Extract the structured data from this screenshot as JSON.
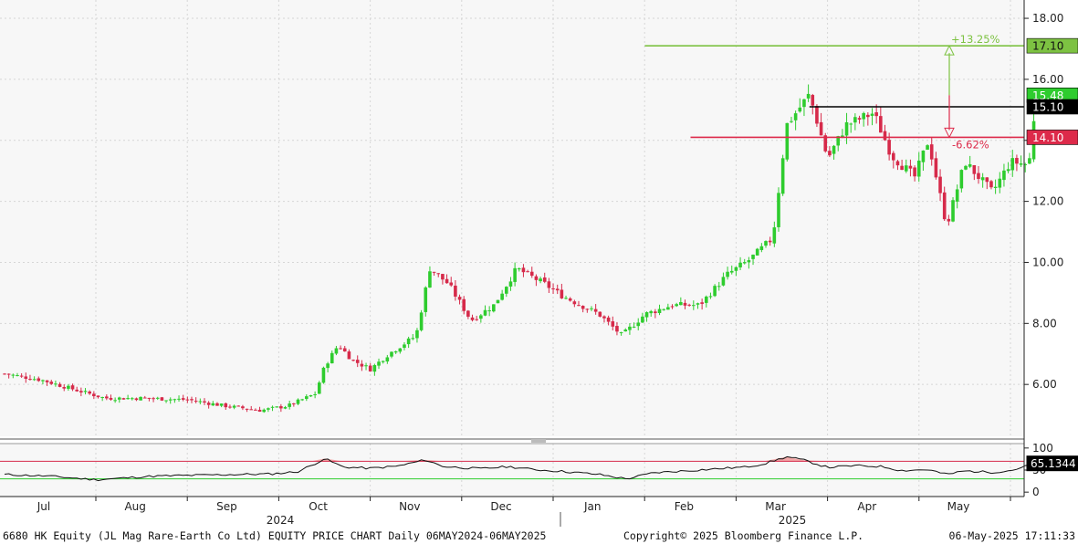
{
  "chart_data": {
    "type": "candlestick",
    "ticker_line": "6680 HK Equity (JL Mag Rare-Earth Co Ltd) EQUITY PRICE CHART  Daily 06MAY2024-06MAY2025",
    "copyright": "Copyright© 2025 Bloomberg Finance L.P.",
    "timestamp": "06-May-2025 17:11:33",
    "price_axis": {
      "ylim": [
        4.3,
        18.6
      ],
      "ticks": [
        {
          "v": 6,
          "label": "6.00"
        },
        {
          "v": 8,
          "label": "8.00"
        },
        {
          "v": 10,
          "label": "10.00"
        },
        {
          "v": 12,
          "label": "12.00"
        },
        {
          "v": 14,
          "label": "14.00"
        },
        {
          "v": 16,
          "label": "16.00"
        },
        {
          "v": 18,
          "label": "18.00"
        }
      ]
    },
    "rsi_axis": {
      "ylim": [
        -10,
        110
      ],
      "ticks": [
        {
          "v": 100,
          "label": "100"
        },
        {
          "v": 50,
          "label": "50"
        },
        {
          "v": 0,
          "label": "0"
        }
      ],
      "upper": 70,
      "lower": 30,
      "current": {
        "v": 65.1344,
        "label": "65.1344"
      }
    },
    "months": [
      "Jul",
      "Aug",
      "Sep",
      "Oct",
      "Nov",
      "Dec",
      "Jan",
      "Feb",
      "Mar",
      "Apr",
      "May"
    ],
    "years": [
      "2024",
      "2025"
    ],
    "levels": [
      {
        "name": "resistance",
        "value": 17.1,
        "label": "17.10",
        "color": "#7dc242",
        "start_month": 7.0
      },
      {
        "name": "pivot",
        "value": 15.1,
        "label": "15.10",
        "color": "#000000",
        "start_month": 8.8
      },
      {
        "name": "support",
        "value": 14.1,
        "label": "14.10",
        "color": "#dd2a4a",
        "start_month": 7.5
      }
    ],
    "last_price": {
      "value": 15.48,
      "label": "15.48",
      "color": "#2ecc2e"
    },
    "change_up": {
      "label": "+13.25%",
      "color": "#7dc242"
    },
    "change_down": {
      "label": "-6.62%",
      "color": "#dd2a4a"
    },
    "close_path": [
      [
        0.0,
        6.35
      ],
      [
        0.4,
        6.15
      ],
      [
        0.8,
        5.8
      ],
      [
        1.1,
        5.55
      ],
      [
        1.5,
        5.55
      ],
      [
        2.0,
        5.5
      ],
      [
        2.4,
        5.3
      ],
      [
        2.8,
        5.15
      ],
      [
        3.1,
        5.3
      ],
      [
        3.4,
        5.7
      ],
      [
        3.5,
        6.6
      ],
      [
        3.65,
        7.3
      ],
      [
        3.8,
        6.8
      ],
      [
        4.0,
        6.5
      ],
      [
        4.2,
        7.0
      ],
      [
        4.5,
        7.6
      ],
      [
        4.65,
        9.8
      ],
      [
        4.85,
        9.3
      ],
      [
        5.1,
        8.1
      ],
      [
        5.35,
        8.6
      ],
      [
        5.6,
        9.8
      ],
      [
        5.9,
        9.3
      ],
      [
        6.1,
        8.9
      ],
      [
        6.5,
        8.3
      ],
      [
        6.75,
        7.6
      ],
      [
        7.0,
        8.3
      ],
      [
        7.3,
        8.6
      ],
      [
        7.6,
        8.6
      ],
      [
        7.9,
        9.6
      ],
      [
        8.15,
        10.1
      ],
      [
        8.4,
        10.8
      ],
      [
        8.55,
        14.5
      ],
      [
        8.8,
        15.5
      ],
      [
        9.0,
        13.4
      ],
      [
        9.2,
        14.5
      ],
      [
        9.5,
        14.9
      ],
      [
        9.7,
        13.5
      ],
      [
        9.95,
        12.8
      ],
      [
        10.1,
        14.0
      ],
      [
        10.3,
        11.2
      ],
      [
        10.5,
        13.3
      ],
      [
        10.8,
        12.3
      ],
      [
        11.0,
        13.3
      ],
      [
        11.2,
        13.2
      ],
      [
        11.28,
        15.48
      ]
    ],
    "rsi_path": [
      [
        0.0,
        40
      ],
      [
        0.5,
        36
      ],
      [
        1.0,
        28
      ],
      [
        1.3,
        32
      ],
      [
        1.6,
        36
      ],
      [
        2.0,
        38
      ],
      [
        2.5,
        40
      ],
      [
        2.9,
        41
      ],
      [
        3.2,
        46
      ],
      [
        3.35,
        60
      ],
      [
        3.5,
        76
      ],
      [
        3.7,
        57
      ],
      [
        4.0,
        54
      ],
      [
        4.3,
        59
      ],
      [
        4.6,
        73
      ],
      [
        4.8,
        58
      ],
      [
        5.2,
        53
      ],
      [
        5.5,
        58
      ],
      [
        5.8,
        51
      ],
      [
        6.1,
        47
      ],
      [
        6.5,
        40
      ],
      [
        6.8,
        30
      ],
      [
        7.1,
        44
      ],
      [
        7.5,
        49
      ],
      [
        7.8,
        53
      ],
      [
        8.1,
        57
      ],
      [
        8.3,
        64
      ],
      [
        8.55,
        80
      ],
      [
        8.75,
        72
      ],
      [
        9.0,
        56
      ],
      [
        9.3,
        60
      ],
      [
        9.6,
        58
      ],
      [
        9.8,
        49
      ],
      [
        10.1,
        51
      ],
      [
        10.3,
        40
      ],
      [
        10.5,
        48
      ],
      [
        10.8,
        45
      ],
      [
        11.0,
        49
      ],
      [
        11.28,
        65.1
      ]
    ]
  }
}
